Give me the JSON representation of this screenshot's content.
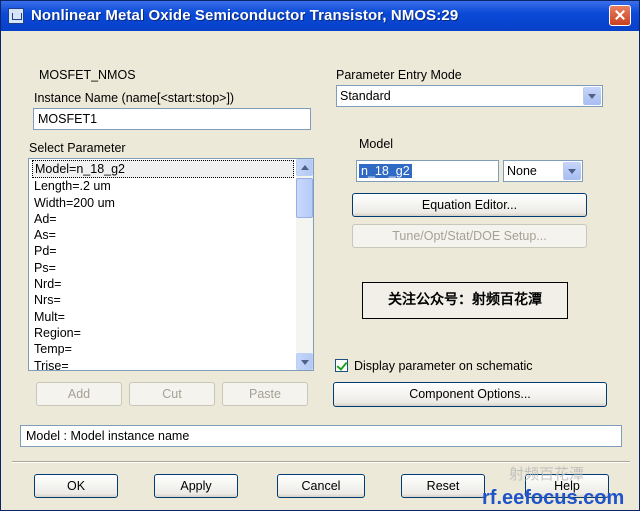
{
  "window": {
    "title": "Nonlinear Metal Oxide Semiconductor Transistor, NMOS:29"
  },
  "component_type": "MOSFET_NMOS",
  "instance": {
    "label": "Instance Name  (name[<start:stop>])",
    "value": "MOSFET1"
  },
  "entry_mode": {
    "label": "Parameter Entry Mode",
    "value": "Standard"
  },
  "select_parameter": {
    "label": "Select Parameter",
    "items": [
      "Model=n_18_g2",
      "Length=.2 um",
      "Width=200 um",
      "Ad=",
      "As=",
      "Pd=",
      "Ps=",
      "Nrd=",
      "Nrs=",
      "Mult=",
      "Region=",
      "Temp=",
      "Trise="
    ]
  },
  "model": {
    "label": "Model",
    "value": "n_18_g2",
    "unit_value": "None"
  },
  "buttons": {
    "equation_editor": "Equation Editor...",
    "tune": "Tune/Opt/Stat/DOE Setup...",
    "add": "Add",
    "cut": "Cut",
    "paste": "Paste",
    "component_options": "Component Options...",
    "ok": "OK",
    "apply": "Apply",
    "cancel": "Cancel",
    "reset": "Reset",
    "help": "Help"
  },
  "stamp_text": "关注公众号：射频百花潭",
  "display_parameter": {
    "label": "Display parameter on schematic",
    "checked": true
  },
  "status": "Model : Model instance name",
  "watermark": {
    "cn": "射频百花潭",
    "url": "rf.eefocus.com"
  }
}
